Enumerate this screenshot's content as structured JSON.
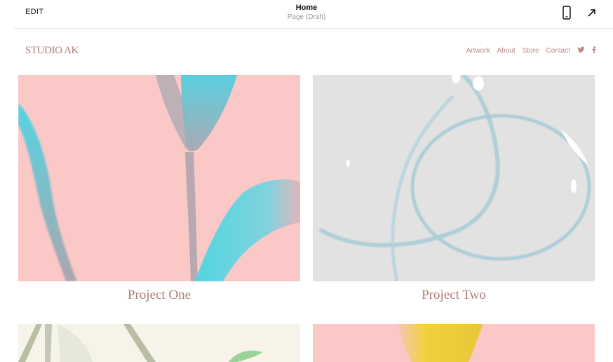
{
  "editor": {
    "edit_label": "EDIT",
    "page_title": "Home",
    "page_status": "Page (Draft)",
    "icons": [
      "mobile-preview-icon",
      "open-external-icon"
    ]
  },
  "site": {
    "logo": "STUDIO AK",
    "nav": [
      "Artwork",
      "About",
      "Store",
      "Contact"
    ],
    "social": [
      "twitter-icon",
      "facebook-icon"
    ]
  },
  "projects": [
    {
      "title": "Project One"
    },
    {
      "title": "Project Two"
    }
  ],
  "colors": {
    "accent": "#b07c79",
    "tile_pink": "#fbc8c8",
    "tile_gray": "#e2e2e2",
    "tile_cream": "#f6f3e9",
    "cyan": "#49d6e3",
    "yellow": "#f1d13a"
  }
}
